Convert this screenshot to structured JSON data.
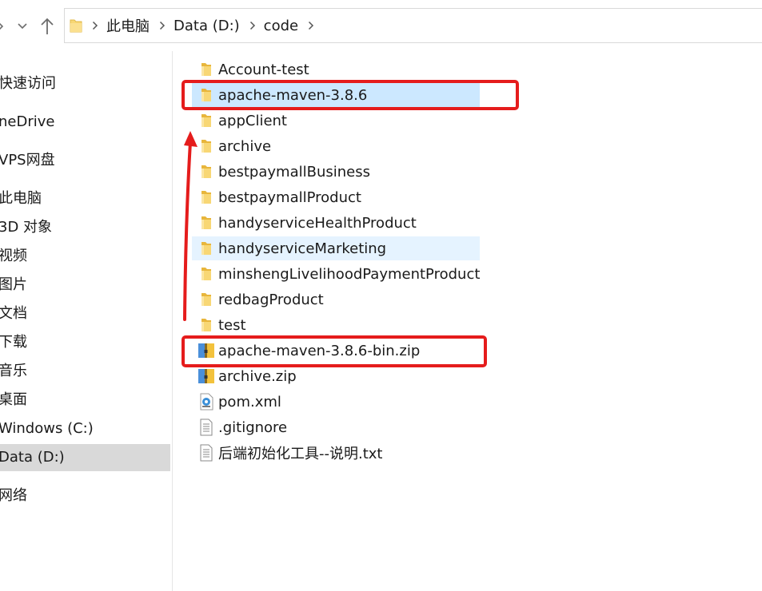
{
  "toolbar": {
    "forward_icon": "chevron-right-icon",
    "recent_icon": "chevron-down-icon",
    "up_icon": "arrow-up-icon",
    "breadcrumb": [
      "此电脑",
      "Data (D:)",
      "code"
    ]
  },
  "nav_pane": {
    "items": [
      "快速访问",
      "neDrive",
      "VPS网盘",
      "此电脑",
      "3D 对象",
      "视频",
      "图片",
      "文档",
      "下载",
      "音乐",
      "桌面",
      "Windows (C:)",
      "Data (D:)",
      "网络"
    ],
    "selected": "Data (D:)"
  },
  "files": [
    {
      "name": "Account-test",
      "type": "folder"
    },
    {
      "name": "apache-maven-3.8.6",
      "type": "folder",
      "state": "selected"
    },
    {
      "name": "appClient",
      "type": "folder"
    },
    {
      "name": "archive",
      "type": "folder"
    },
    {
      "name": "bestpaymallBusiness",
      "type": "folder"
    },
    {
      "name": "bestpaymallProduct",
      "type": "folder"
    },
    {
      "name": "handyserviceHealthProduct",
      "type": "folder"
    },
    {
      "name": "handyserviceMarketing",
      "type": "folder",
      "state": "hover"
    },
    {
      "name": "minshengLivelihoodPaymentProduct",
      "type": "folder"
    },
    {
      "name": "redbagProduct",
      "type": "folder"
    },
    {
      "name": "test",
      "type": "folder"
    },
    {
      "name": "apache-maven-3.8.6-bin.zip",
      "type": "zip"
    },
    {
      "name": "archive.zip",
      "type": "zip"
    },
    {
      "name": "pom.xml",
      "type": "xml"
    },
    {
      "name": ".gitignore",
      "type": "text"
    },
    {
      "name": "后端初始化工具--说明.txt",
      "type": "text"
    }
  ],
  "colors": {
    "selection": "#cce8ff",
    "hover": "#e5f3ff",
    "nav_selected": "#d9d9d9",
    "annotation_red": "#e51c1c",
    "folder_yellow": "#f8d775"
  }
}
